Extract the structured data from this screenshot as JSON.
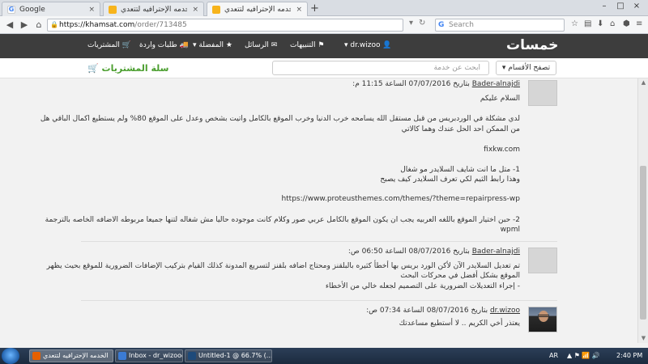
{
  "colors": {
    "site_header": "#3d3d3d",
    "cart_green": "#4a9e2e",
    "logo_accent": "#f7b41c"
  },
  "browser": {
    "tabs": [
      {
        "title": "Google",
        "icon": "google-favicon",
        "close": "×"
      },
      {
        "title": "الخدمه الإحترافيه لتتعدي",
        "icon": "khamsat-favicon",
        "close": "×"
      },
      {
        "title": "الخدمه الإحترافيه لتتعدي",
        "icon": "khamsat-favicon",
        "close": "×"
      }
    ],
    "new_tab": "+",
    "url_host": "https://khamsat.com",
    "url_path": "/order/713485",
    "search_placeholder": "Search",
    "window_buttons": [
      "–",
      "□",
      "×"
    ]
  },
  "site": {
    "logo_text": "خمسات",
    "nav": {
      "user": "dr.wizoo",
      "notifications": "التنبيهات",
      "messages": "الرسائل",
      "favorites": "المفضلة",
      "incoming_requests": "طلبات واردة",
      "purchases": "المشتريات"
    },
    "browse_categories": "تصفح الأقسام",
    "service_search_placeholder": "ابحث عن خدمة",
    "cart_label": "سلة المشتريات"
  },
  "posts": [
    {
      "author": "Bader-alnajdi",
      "meta": "بتاريخ 07/07/2016 الساعة 11:15 م:",
      "lines": [
        "السلام عليكم",
        "لدي مشكلة في الوردبريس من قبل مستقل الله يسامحه خرب الدنيا وخرب الموقع بالكامل واتيت بشخص وعدل على الموقع 80% ولم يستطيع اكمال الباقي هل",
        "من الممكن احد الحل عندك وهما كالاتي",
        "fixkw.com",
        "1- متل ما انت شايف السلايدر مو شغال",
        "وهذا رابط الثيم لكي تعرف السلايدر كيف يصبح",
        "https://www.proteusthemes.com/themes/?theme=repairpress-wp",
        "2- حبن اختيار الموقع باللغه العربيه يجب ان يكون الموقع بالكامل عربي صور وكلام كانت موجوده حاليا مش شغاله لتنها جميعا مربوطه الاضافه الخاصه بالترجمة",
        "wpml"
      ]
    },
    {
      "author": "Bader-alnajdi",
      "meta": "بتاريخ 08/07/2016 الساعة 06:50 ص:",
      "lines": [
        "تم تعديل السلايدر الآن لأكن الورد بريس بها أخطأ كثيره بالبلقنز ومحتاج اضافه بلقنز لتسريع المدونة كذلك القيام بتركيب الإضافات الضرورية للموقع بحيث يظهر",
        "الموقع بشكل أفضل في محركات البحث",
        "- إجراء التعديلات الضرورية على التصميم لجعله خالي من الأخطاء"
      ]
    },
    {
      "author": "dr.wizoo",
      "meta": "بتاريخ 08/07/2016 الساعة 07:34 ص:",
      "lines": [
        "يعتذر أخي الكريم .. لا أستطيع مساعدتك"
      ]
    }
  ],
  "taskbar": {
    "tasks": [
      {
        "label": "الخدمه الإحترافيه لتتعدي"
      },
      {
        "label": "Inbox - dr_wizoo@ya..."
      },
      {
        "label": "Untitled-1 @ 66.7% (..."
      }
    ],
    "lang": "AR",
    "time": "2:40 PM"
  }
}
